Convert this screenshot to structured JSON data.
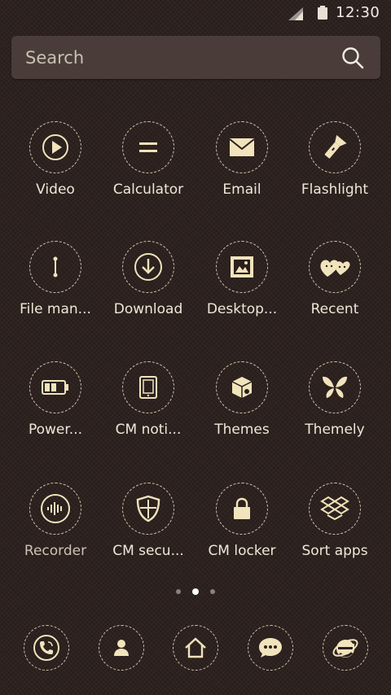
{
  "status_bar": {
    "time": "12:30",
    "icons": [
      "signal-icon",
      "battery-icon"
    ]
  },
  "search": {
    "placeholder": "Search",
    "icon": "search-icon"
  },
  "apps": [
    {
      "label": "Video",
      "icon": "play-icon"
    },
    {
      "label": "Calculator",
      "icon": "equals-icon"
    },
    {
      "label": "Email",
      "icon": "envelope-icon"
    },
    {
      "label": "Flashlight",
      "icon": "flashlight-icon"
    },
    {
      "label": "File man...",
      "icon": "file-manager-icon"
    },
    {
      "label": "Download",
      "icon": "download-icon"
    },
    {
      "label": "Desktop...",
      "icon": "picture-icon"
    },
    {
      "label": "Recent",
      "icon": "hearts-icon"
    },
    {
      "label": "Power...",
      "icon": "battery-icon"
    },
    {
      "label": "CM noti...",
      "icon": "tablet-icon"
    },
    {
      "label": "Themes",
      "icon": "theme-box-icon"
    },
    {
      "label": "Themely",
      "icon": "butterfly-icon"
    },
    {
      "label": "Recorder",
      "icon": "soundwave-icon"
    },
    {
      "label": "CM secu...",
      "icon": "shield-icon"
    },
    {
      "label": "CM locker",
      "icon": "lock-icon"
    },
    {
      "label": "Sort apps",
      "icon": "dropbox-icon"
    }
  ],
  "page_indicator": {
    "pages": 3,
    "current": 2
  },
  "dock": [
    {
      "icon": "phone-icon"
    },
    {
      "icon": "contacts-icon"
    },
    {
      "icon": "home-icon"
    },
    {
      "icon": "messages-icon"
    },
    {
      "icon": "browser-icon"
    }
  ],
  "colors": {
    "background": "#2a1f1c",
    "accent": "#f1e3bb",
    "search_bg": "#4a3d39"
  }
}
